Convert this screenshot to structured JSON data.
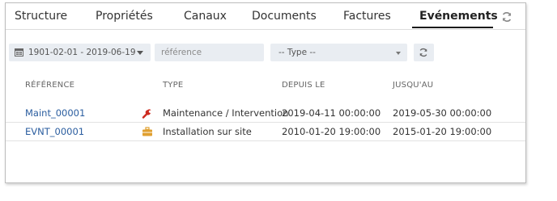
{
  "tabs": [
    {
      "label": "Structure"
    },
    {
      "label": "Propriétés"
    },
    {
      "label": "Canaux"
    },
    {
      "label": "Documents"
    },
    {
      "label": "Factures"
    },
    {
      "label": "Evénements"
    }
  ],
  "active_tab": "Evénements",
  "filters": {
    "date_range": "1901-02-01 - 2019-06-19",
    "reference_placeholder": "référence",
    "type_select": "-- Type --"
  },
  "table": {
    "columns": [
      "RÉFÉRENCE",
      "TYPE",
      "DEPUIS LE",
      "JUSQU'AU"
    ],
    "rows": [
      {
        "reference": "Maint_00001",
        "type_icon": "wrench-icon",
        "type": "Maintenance / Intervention",
        "since": "2019-04-11 00:00:00",
        "until": "2019-05-30 00:00:00"
      },
      {
        "reference": "EVNT_00001",
        "type_icon": "briefcase-icon",
        "type": "Installation sur site",
        "since": "2010-01-20 19:00:00",
        "until": "2015-01-20 19:00:00"
      }
    ]
  },
  "colors": {
    "link": "#2a5d9f",
    "wrench": "#cc2a1f",
    "briefcase": "#e0a030",
    "filter_bg": "#e9edf2"
  }
}
